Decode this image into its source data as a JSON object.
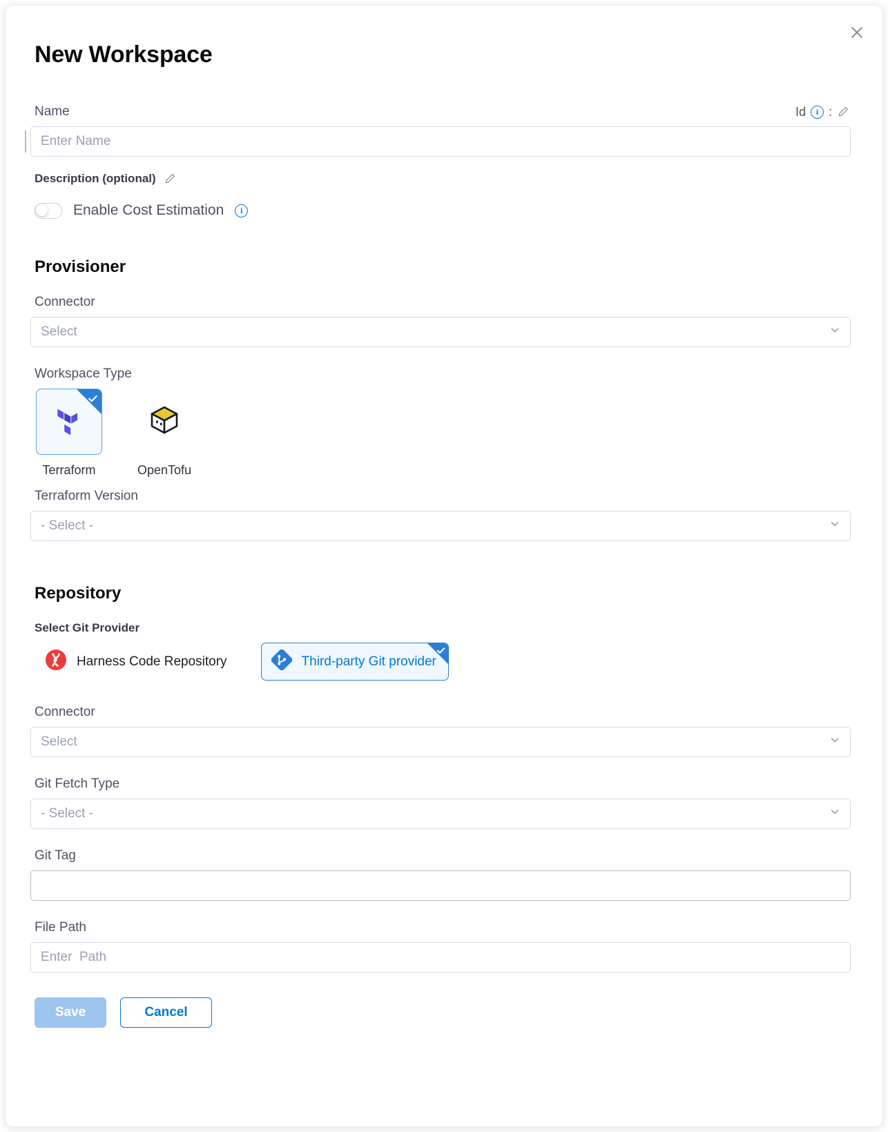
{
  "dialog": {
    "title": "New Workspace",
    "close_icon": "close-icon"
  },
  "name_field": {
    "label": "Name",
    "placeholder": "Enter Name",
    "value": "",
    "id_label": "Id",
    "id_info_icon": "info-icon",
    "id_separator": ":",
    "id_edit_icon": "pencil-icon"
  },
  "description": {
    "label": "Description (optional)",
    "edit_icon": "pencil-icon"
  },
  "cost_estimation": {
    "label": "Enable Cost Estimation",
    "info_icon": "info-icon",
    "enabled": false
  },
  "provisioner": {
    "heading": "Provisioner",
    "connector": {
      "label": "Connector",
      "placeholder": "Select",
      "value": ""
    },
    "workspace_type": {
      "label": "Workspace Type",
      "options": [
        {
          "name": "Terraform",
          "icon": "terraform-icon",
          "selected": true
        },
        {
          "name": "OpenTofu",
          "icon": "opentofu-icon",
          "selected": false
        }
      ]
    },
    "version": {
      "label": "Terraform Version",
      "placeholder": "- Select -",
      "value": ""
    }
  },
  "repository": {
    "heading": "Repository",
    "git_provider": {
      "label": "Select Git Provider",
      "options": [
        {
          "name": "Harness Code Repository",
          "icon": "harness-icon",
          "selected": false
        },
        {
          "name": "Third-party Git provider",
          "icon": "git-icon",
          "selected": true
        }
      ]
    },
    "connector": {
      "label": "Connector",
      "placeholder": "Select",
      "value": ""
    },
    "fetch_type": {
      "label": "Git Fetch Type",
      "placeholder": "- Select -",
      "value": ""
    },
    "git_tag": {
      "label": "Git Tag",
      "placeholder": "",
      "value": ""
    },
    "file_path": {
      "label": "File Path",
      "placeholder": "Enter  Path",
      "value": ""
    }
  },
  "footer": {
    "save_label": "Save",
    "cancel_label": "Cancel"
  },
  "colors": {
    "accent_blue": "#0278d5",
    "selected_border": "#2b7fd4",
    "terraform_purple": "#5c4ee5",
    "opentofu_yellow": "#ffda18",
    "harness_red": "#ed3b3b",
    "save_disabled": "#9dc5ee"
  }
}
